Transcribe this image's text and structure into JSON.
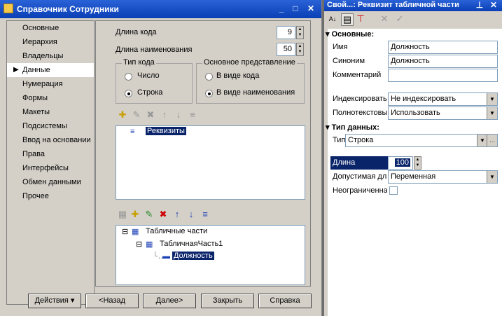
{
  "left_window": {
    "title": "Справочник Сотрудники",
    "controls": {
      "minimize": "_",
      "maximize": "□",
      "close": "✕"
    },
    "tabs": [
      "Основные",
      "Иерархия",
      "Владельцы",
      "Данные",
      "Нумерация",
      "Формы",
      "Макеты",
      "Подсистемы",
      "Ввод на основании",
      "Права",
      "Интерфейсы",
      "Обмен данными",
      "Прочее"
    ],
    "active_tab": "Данные",
    "code_length_label": "Длина кода",
    "code_length_value": "9",
    "name_length_label": "Длина наименования",
    "name_length_value": "50",
    "code_type": {
      "title": "Тип кода",
      "option1": "Число",
      "option2": "Строка",
      "selected": "Строка"
    },
    "main_repr": {
      "title": "Основное представление",
      "option1": "В виде кода",
      "option2": "В виде наименования",
      "selected": "В виде наименования"
    },
    "attributes_tree": {
      "root": "Реквизиты"
    },
    "tabular_tree": {
      "root": "Табличные части",
      "child": "ТабличнаяЧасть1",
      "leaf": "Должность"
    },
    "buttons": {
      "actions": "Действия",
      "back": "<Назад",
      "next": "Далее>",
      "close": "Закрыть",
      "help": "Справка"
    }
  },
  "right_window": {
    "title": "Свой...: Реквизит табличной части",
    "pin": "⊥",
    "close": "✕",
    "sections": {
      "main": "Основные:",
      "datatype": "Тип данных:"
    },
    "props": {
      "name_label": "Имя",
      "name_value": "Должность",
      "synonym_label": "Синоним",
      "synonym_value": "Должность",
      "comment_label": "Комментарий",
      "comment_value": "",
      "index_label": "Индексировать",
      "index_value": "Не индексировать",
      "fulltext_label": "Полнотекстовый поиск",
      "fulltext_value": "Использовать",
      "type_label": "Тип",
      "type_value": "Строка",
      "length_label": "Длина",
      "length_value": "100",
      "allowed_label": "Допустимая длина",
      "allowed_value": "Переменная",
      "unlimited_label": "Неограниченная"
    }
  },
  "colors": {
    "title_blue": "#0a3fb5",
    "selection": "#0a246a",
    "face": "#d4d0c8"
  }
}
